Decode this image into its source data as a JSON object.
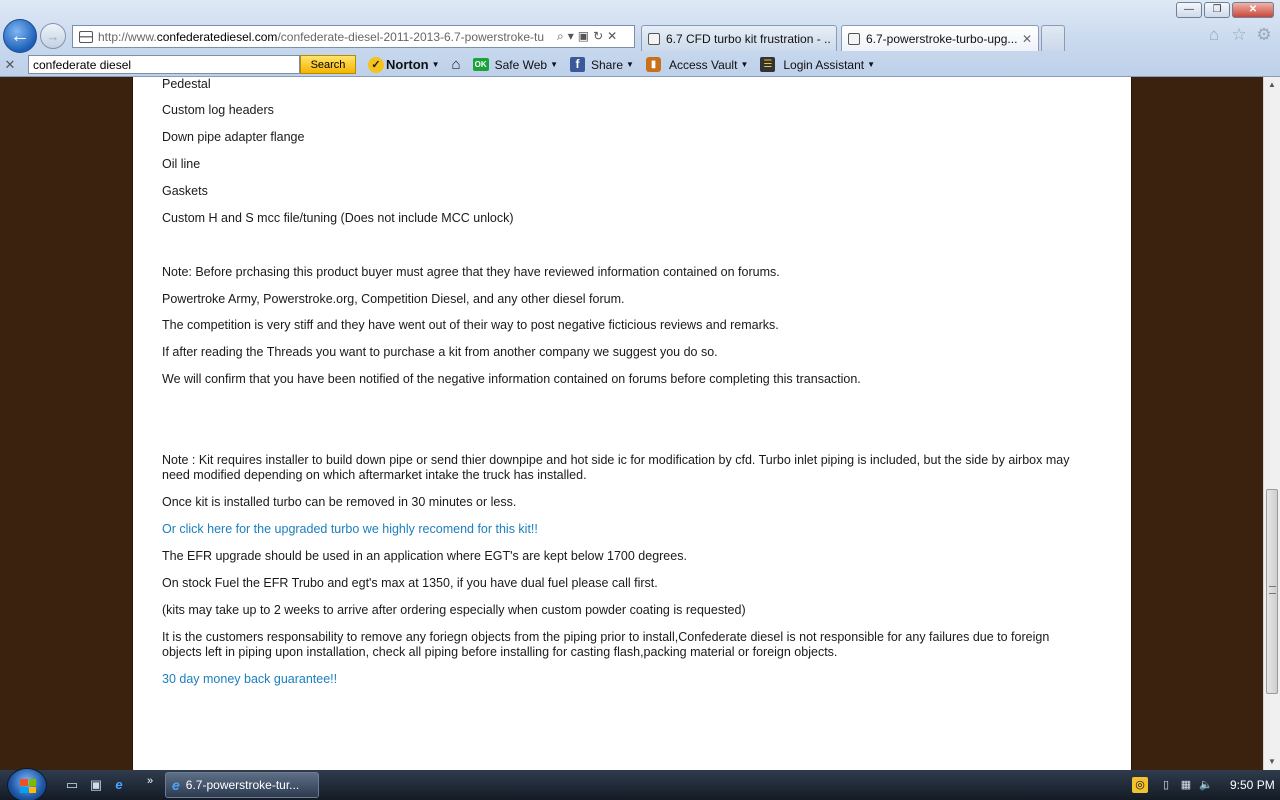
{
  "browser": {
    "window_controls": {
      "minimize": "—",
      "maximize": "❐",
      "close": "✕"
    },
    "address": {
      "url_prefix": "http://www.",
      "url_domain": "confederatediesel.com",
      "url_rest": "/confederate-diesel-2011-2013-6.7-powerstroke-tu"
    },
    "tabs": [
      {
        "label": "6.7 CFD turbo kit frustration - ..."
      },
      {
        "label": "6.7-powerstroke-turbo-upg...",
        "close": "✕"
      }
    ],
    "toolbar": {
      "close": "✕",
      "search_value": "confederate diesel",
      "search_button": "Search",
      "norton": "Norton",
      "safe_web": "Safe Web",
      "share": "Share",
      "access_vault": "Access Vault",
      "login_assistant": "Login Assistant",
      "ok_badge": "OK",
      "fb_glyph": "f"
    }
  },
  "page": {
    "lines": [
      {
        "text": "Pedestal"
      },
      {
        "text": "Custom log headers"
      },
      {
        "text": "Down pipe adapter flange"
      },
      {
        "text": "Oil line"
      },
      {
        "text": "Gaskets"
      },
      {
        "text": "Custom H and S mcc file/tuning (Does not include MCC unlock)"
      },
      {
        "text": "Note: Before prchasing this product buyer must agree that they have reviewed information contained on forums."
      },
      {
        "text": "Powertroke Army, Powerstroke.org, Competition Diesel, and any other diesel forum."
      },
      {
        "text": "The competition is very stiff and they have went out of their way to post negative ficticious reviews and remarks."
      },
      {
        "text": "If after reading the Threads you want to purchase a kit from another company we suggest you do so."
      },
      {
        "text": "We will confirm that you have been notified of the negative information contained on forums before completing this transaction."
      },
      {
        "text": " Note : Kit requires installer to build down pipe or send thier downpipe and hot side ic for modification by cfd. Turbo inlet piping is included, but the side by airbox may need modified depending on which aftermarket intake the truck has installed."
      },
      {
        "text": "Once kit is installed turbo can be removed in 30 minutes or less."
      },
      {
        "text": "Or click here for the upgraded turbo we highly recomend for this kit!!"
      },
      {
        "text": "The EFR upgrade should be used in an application where EGT's are kept below 1700 degrees."
      },
      {
        "text": "On stock Fuel the EFR Trubo and egt's max at 1350, if you have dual fuel please call first."
      },
      {
        "text": "(kits may take up to 2 weeks to arrive after ordering especially when custom powder coating is requested)"
      },
      {
        "text": "It is the customers responsability to remove any foriegn objects from the piping prior to install,Confederate diesel is not responsible for any failures due to foreign objects left in piping upon installation, check all piping before installing for casting flash,packing material or foreign objects."
      },
      {
        "text": "30 day money back guarantee!!"
      }
    ],
    "link_color": "#1a7fbf"
  },
  "taskbar": {
    "task_label": "6.7-powerstroke-tur...",
    "clock": "9:50 PM",
    "more": "»"
  }
}
